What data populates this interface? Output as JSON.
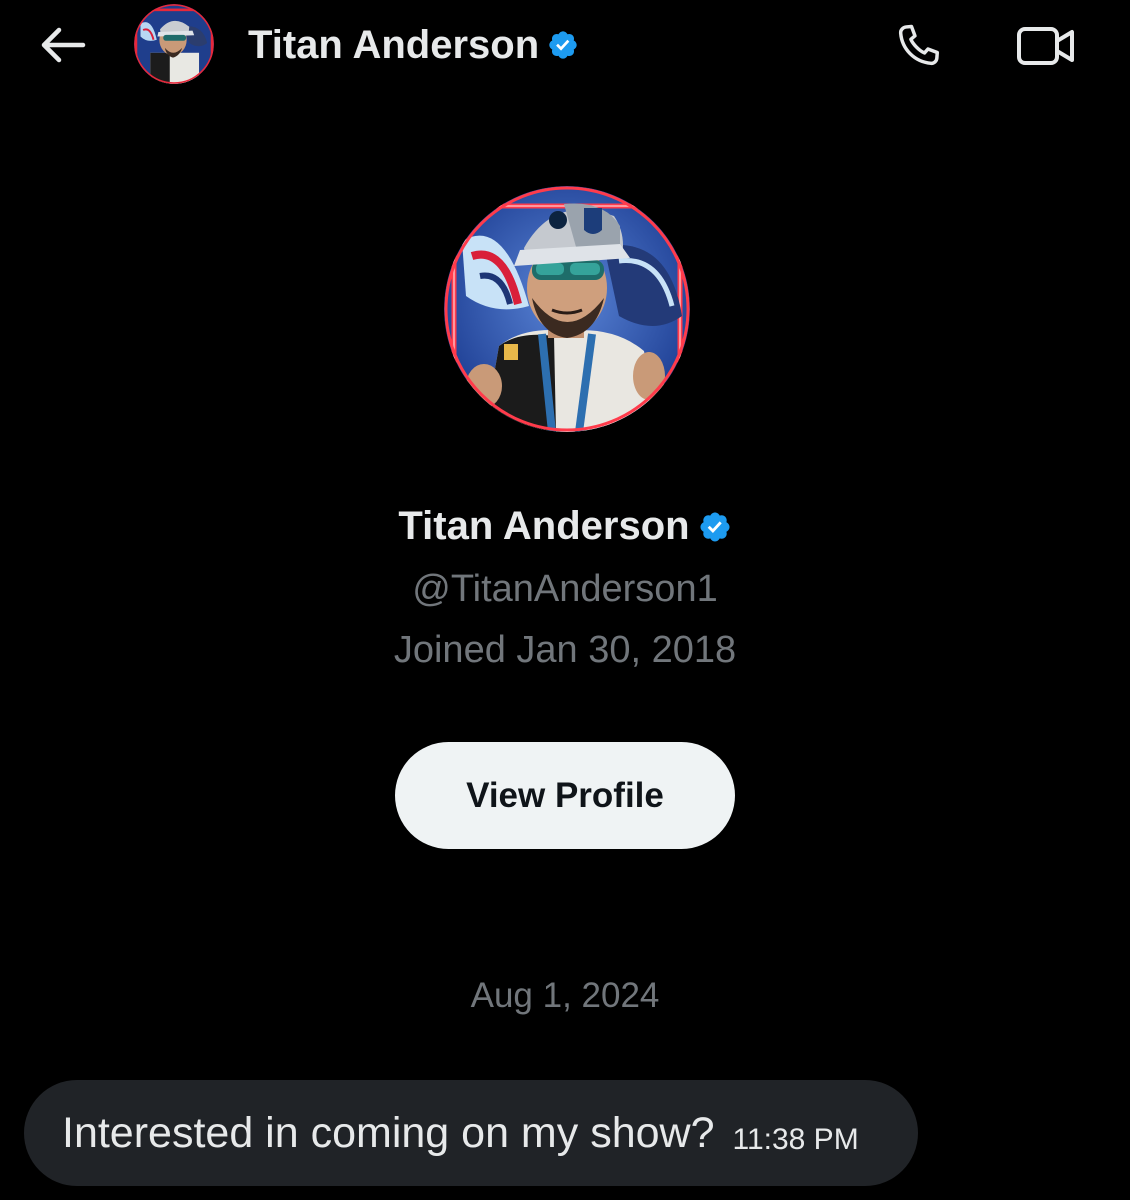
{
  "header": {
    "back_icon": "arrow-left-icon",
    "name": "Titan Anderson",
    "verified_icon": "verified-badge-icon",
    "call_icon": "phone-icon",
    "video_icon": "video-camera-icon"
  },
  "profile": {
    "name": "Titan Anderson",
    "handle": "@TitanAnderson1",
    "joined": "Joined Jan 30, 2018",
    "view_profile_label": "View Profile"
  },
  "conversation": {
    "date": "Aug 1, 2024",
    "messages": [
      {
        "text": "Interested in coming on my show?",
        "time": "11:38 PM"
      }
    ]
  },
  "colors": {
    "background": "#000000",
    "primary_text": "#e7e9ea",
    "secondary_text": "#71767b",
    "verified_blue": "#1d9bf0",
    "button_bg": "#eff3f4",
    "bubble_bg": "#202327"
  }
}
